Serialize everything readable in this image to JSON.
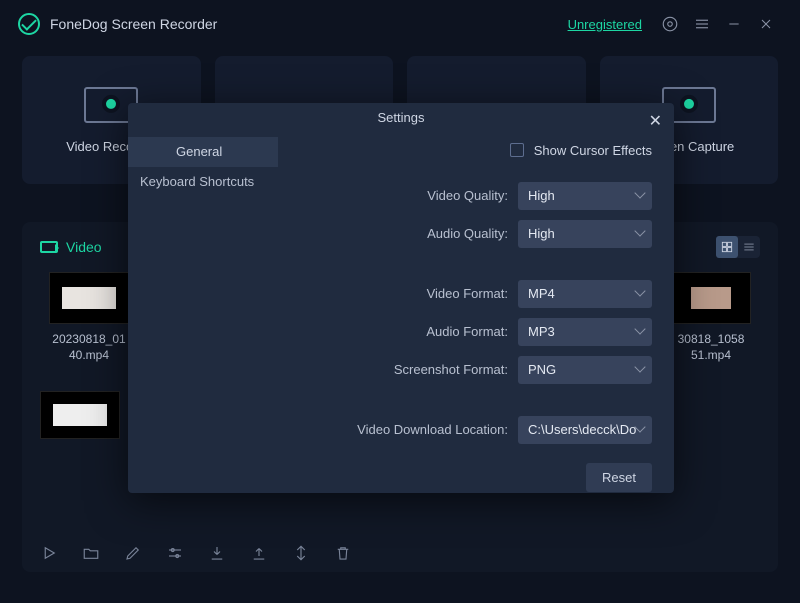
{
  "header": {
    "app_title": "FoneDog Screen Recorder",
    "unregistered": "Unregistered"
  },
  "modes": {
    "video": "Video Recorder",
    "capture": "Screen Capture"
  },
  "library": {
    "tab": "Video",
    "file1": "20230818_01\n40.mp4",
    "file2": "30818_1058\n51.mp4"
  },
  "settings": {
    "title": "Settings",
    "tabs": {
      "general": "General",
      "shortcuts": "Keyboard Shortcuts"
    },
    "cursor_label": "Show Cursor Effects",
    "rows": {
      "vq_label": "Video Quality:",
      "vq_val": "High",
      "aq_label": "Audio Quality:",
      "aq_val": "High",
      "vf_label": "Video Format:",
      "vf_val": "MP4",
      "af_label": "Audio Format:",
      "af_val": "MP3",
      "sf_label": "Screenshot Format:",
      "sf_val": "PNG",
      "dl_label": "Video Download Location:",
      "dl_val": "C:\\Users\\decck\\Do"
    },
    "reset": "Reset"
  }
}
